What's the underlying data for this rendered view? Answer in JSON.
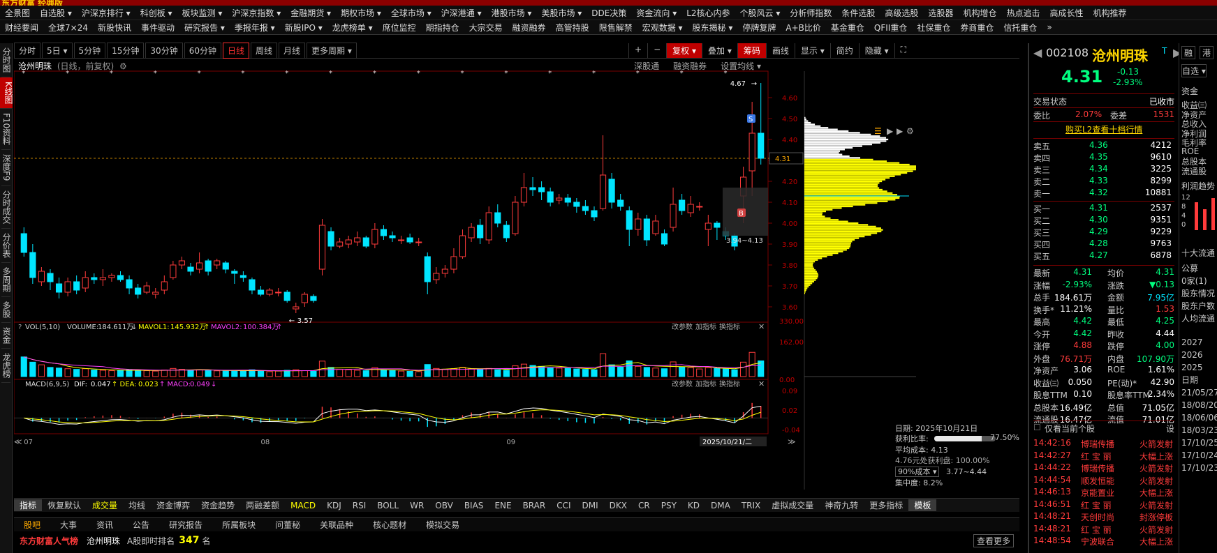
{
  "app": {
    "logo": "东方财富 经典版"
  },
  "menu_row1": [
    "全景图",
    "自选股 ▾",
    "沪深京排行 ▾",
    "科创板 ▾",
    "板块监测 ▾",
    "沪深京指数 ▾",
    "金融期货 ▾",
    "期权市场 ▾",
    "全球市场 ▾",
    "沪深港通 ▾",
    "港股市场 ▾",
    "美股市场 ▾",
    "DDE决策",
    "资金流向 ▾",
    "L2核心内参",
    "个股风云 ▾",
    "分析师指数",
    "条件选股",
    "高级选股",
    "选股器",
    "机构增仓",
    "热点追击",
    "高成长性",
    "机构推荐"
  ],
  "menu_row2": [
    "财经要闻",
    "全球7×24",
    "新股快讯",
    "事件驱动",
    "研究报告 ▾",
    "季报年报 ▾",
    "新股IPO ▾",
    "龙虎榜单 ▾",
    "席位监控",
    "期指持仓",
    "大宗交易",
    "融资融券",
    "高管持股",
    "限售解禁",
    "宏观数据 ▾",
    "股东揭秘 ▾",
    "停牌复牌",
    "A+B比价",
    "基金重仓",
    "QFII重仓",
    "社保重仓",
    "券商重仓",
    "信托重仓",
    "»"
  ],
  "left_nav": [
    {
      "label": "分时图",
      "active": false
    },
    {
      "label": "K线图",
      "active": true
    },
    {
      "label": "F10资料",
      "active": false
    },
    {
      "label": "深度F9",
      "active": false
    },
    {
      "label": "分时成交",
      "active": false
    },
    {
      "label": "分价表",
      "active": false
    },
    {
      "label": "多周期",
      "active": false
    },
    {
      "label": "多股",
      "active": false
    },
    {
      "label": "资金",
      "active": false
    },
    {
      "label": "龙虎榜",
      "active": false
    }
  ],
  "periods": [
    {
      "label": "分时",
      "active": false
    },
    {
      "label": "5日 ▾",
      "active": false
    },
    {
      "label": "5分钟",
      "active": false
    },
    {
      "label": "15分钟",
      "active": false
    },
    {
      "label": "30分钟",
      "active": false
    },
    {
      "label": "60分钟",
      "active": false
    },
    {
      "label": "日线",
      "active": true
    },
    {
      "label": "周线",
      "active": false
    },
    {
      "label": "月线",
      "active": false
    },
    {
      "label": "更多周期 ▾",
      "active": false
    }
  ],
  "toolbar_right": [
    {
      "label": "+",
      "red": false
    },
    {
      "label": "−",
      "red": false
    },
    {
      "label": "复权 ▾",
      "red": true
    },
    {
      "label": "叠加 ▾",
      "red": false
    },
    {
      "label": "筹码",
      "red": true
    },
    {
      "label": "画线",
      "red": false
    },
    {
      "label": "显示 ▾",
      "red": false
    },
    {
      "label": "简约",
      "red": false
    },
    {
      "label": "隐藏 ▾",
      "red": false
    },
    {
      "label": "⛶",
      "red": false
    }
  ],
  "chart_header": {
    "name": "沧州明珠",
    "mode": "(日线，前复权)",
    "links": [
      "深股通",
      "融资融券",
      "设置均线 ▾"
    ]
  },
  "chart_data": {
    "type": "candlestick",
    "title": "沧州明珠 (日线，前复权)",
    "x_month_labels": [
      "07",
      "08",
      "09",
      "10"
    ],
    "x_cursor_label": "2025/10/21/二",
    "ylim": [
      3.55,
      4.7
    ],
    "y_ticks": [
      3.6,
      3.7,
      3.8,
      3.9,
      4.0,
      4.1,
      4.2,
      4.3,
      4.4,
      4.5,
      4.6
    ],
    "current_price": 4.31,
    "annotations": {
      "high_label": "4.67",
      "low_label": "3.57",
      "range_label": "3.94~4.13",
      "buy_marker": "B",
      "sell_marker": "S"
    },
    "candles": [
      [
        3.95,
        3.86,
        3.98,
        3.84
      ],
      [
        3.86,
        3.74,
        3.9,
        3.71
      ],
      [
        3.72,
        3.77,
        3.79,
        3.7
      ],
      [
        3.76,
        3.72,
        3.78,
        3.68
      ],
      [
        3.71,
        3.67,
        3.74,
        3.64
      ],
      [
        3.67,
        3.72,
        3.74,
        3.65
      ],
      [
        3.72,
        3.68,
        3.75,
        3.66
      ],
      [
        3.69,
        3.74,
        3.77,
        3.67
      ],
      [
        3.74,
        3.73,
        3.76,
        3.71
      ],
      [
        3.73,
        3.74,
        3.78,
        3.7
      ],
      [
        3.74,
        3.75,
        3.76,
        3.72
      ],
      [
        3.75,
        3.73,
        3.77,
        3.72
      ],
      [
        3.73,
        3.69,
        3.75,
        3.66
      ],
      [
        3.69,
        3.66,
        3.71,
        3.64
      ],
      [
        3.67,
        3.7,
        3.72,
        3.66
      ],
      [
        3.66,
        3.67,
        3.69,
        3.64
      ],
      [
        3.68,
        3.72,
        3.75,
        3.66
      ],
      [
        3.74,
        3.8,
        3.82,
        3.73
      ],
      [
        3.8,
        3.82,
        3.84,
        3.78
      ],
      [
        3.79,
        3.77,
        3.81,
        3.75
      ],
      [
        3.78,
        3.81,
        3.86,
        3.76
      ],
      [
        3.82,
        3.77,
        3.83,
        3.75
      ],
      [
        3.8,
        3.82,
        3.83,
        3.78
      ],
      [
        3.81,
        3.78,
        3.82,
        3.76
      ],
      [
        3.77,
        3.76,
        3.78,
        3.71
      ],
      [
        3.75,
        3.74,
        3.77,
        3.72
      ],
      [
        3.73,
        3.68,
        3.74,
        3.66
      ],
      [
        3.68,
        3.66,
        3.7,
        3.65
      ],
      [
        3.66,
        3.68,
        3.69,
        3.65
      ],
      [
        3.67,
        3.67,
        3.69,
        3.65
      ],
      [
        3.67,
        3.63,
        3.68,
        3.62
      ],
      [
        3.59,
        3.6,
        3.62,
        3.57
      ],
      [
        3.62,
        3.66,
        3.67,
        3.6
      ],
      [
        3.65,
        3.63,
        3.66,
        3.62
      ],
      [
        3.78,
        3.99,
        4.02,
        3.75
      ],
      [
        3.96,
        3.89,
        3.98,
        3.87
      ],
      [
        3.89,
        3.91,
        3.93,
        3.88
      ],
      [
        3.9,
        3.92,
        3.94,
        3.88
      ],
      [
        3.91,
        3.93,
        3.96,
        3.89
      ],
      [
        3.93,
        3.89,
        3.94,
        3.88
      ],
      [
        3.9,
        3.97,
        4.0,
        3.88
      ],
      [
        3.97,
        3.94,
        3.99,
        3.92
      ],
      [
        3.94,
        3.93,
        3.96,
        3.91
      ],
      [
        3.92,
        3.92,
        3.94,
        3.9
      ],
      [
        3.93,
        3.91,
        3.95,
        3.9
      ],
      [
        3.91,
        3.91,
        3.93,
        3.89
      ],
      [
        3.84,
        3.72,
        3.86,
        3.66
      ],
      [
        3.73,
        3.76,
        3.79,
        3.71
      ],
      [
        3.76,
        3.78,
        3.8,
        3.74
      ],
      [
        3.78,
        3.84,
        3.88,
        3.76
      ],
      [
        3.84,
        3.94,
        3.97,
        3.83
      ],
      [
        3.93,
        3.98,
        4.0,
        3.91
      ],
      [
        3.99,
        3.93,
        4.02,
        3.9
      ],
      [
        3.92,
        4.05,
        4.08,
        3.9
      ],
      [
        4.05,
        4.0,
        4.09,
        3.98
      ],
      [
        3.99,
        3.93,
        4.01,
        3.91
      ],
      [
        3.95,
        4.1,
        4.13,
        3.94
      ],
      [
        4.1,
        4.17,
        4.24,
        4.08
      ],
      [
        4.17,
        4.16,
        4.22,
        4.13
      ],
      [
        4.17,
        4.15,
        4.2,
        4.11
      ],
      [
        4.15,
        4.1,
        4.17,
        4.08
      ],
      [
        4.11,
        4.12,
        4.14,
        4.09
      ],
      [
        4.12,
        4.1,
        4.14,
        4.08
      ],
      [
        4.1,
        4.08,
        4.12,
        4.05
      ],
      [
        4.08,
        4.06,
        4.11,
        4.04
      ],
      [
        4.06,
        4.03,
        4.08,
        4.01
      ],
      [
        4.07,
        4.23,
        4.42,
        4.06
      ],
      [
        4.21,
        4.1,
        4.24,
        4.07
      ],
      [
        4.11,
        4.08,
        4.14,
        4.06
      ],
      [
        4.06,
        3.97,
        4.08,
        3.89
      ],
      [
        3.97,
        4.02,
        4.05,
        3.94
      ],
      [
        4.02,
        3.92,
        4.04,
        3.89
      ],
      [
        3.95,
        4.01,
        4.04,
        3.94
      ],
      [
        3.95,
        3.9,
        3.97,
        3.89
      ],
      [
        3.98,
        4.09,
        4.17,
        3.96
      ],
      [
        4.11,
        4.06,
        4.14,
        4.04
      ],
      [
        4.05,
        4.09,
        4.13,
        4.03
      ],
      [
        4.08,
        4.08,
        4.1,
        4.06
      ],
      [
        3.97,
        4.0,
        4.04,
        3.89
      ],
      [
        4.0,
        3.98,
        4.01,
        3.92
      ],
      [
        3.96,
        3.94,
        3.98,
        3.92
      ],
      [
        3.94,
        3.89,
        3.95,
        3.87
      ],
      [
        4.13,
        4.22,
        4.27,
        4.0
      ],
      [
        4.25,
        4.43,
        4.58,
        4.13
      ],
      [
        4.43,
        4.31,
        4.67,
        4.28
      ]
    ],
    "volume": {
      "label": "VOL(5,10)",
      "ylim": [
        0,
        330
      ],
      "y_ticks": [
        "330.00",
        "162.00",
        "0.00"
      ],
      "last": "184.611万",
      "mavol1": "145.932万",
      "mavol2": "100.384万",
      "values": [
        150,
        110,
        90,
        70,
        65,
        60,
        55,
        60,
        50,
        48,
        45,
        46,
        52,
        48,
        45,
        42,
        50,
        62,
        55,
        48,
        52,
        45,
        44,
        42,
        48,
        45,
        52,
        40,
        38,
        42,
        48,
        52,
        45,
        40,
        118,
        70,
        55,
        52,
        48,
        45,
        68,
        50,
        45,
        42,
        40,
        38,
        92,
        62,
        55,
        60,
        70,
        60,
        55,
        62,
        52,
        48,
        82,
        95,
        85,
        78,
        70,
        65,
        62,
        58,
        55,
        52,
        175,
        90,
        72,
        120,
        78,
        70,
        65,
        60,
        112,
        72,
        68,
        58,
        68,
        62,
        58,
        52,
        110,
        185,
        120
      ]
    },
    "macd": {
      "label": "MACD(6,9,5)",
      "ylim": [
        -0.06,
        0.11
      ],
      "y_ticks": [
        "0.09",
        "0.02",
        "-0.04"
      ],
      "dif": "0.047",
      "dea": "0.023",
      "macd": "0.049"
    }
  },
  "chip_info": {
    "date": "日期: 2025年10月21日",
    "profit_ratio_label": "获利比率:",
    "profit_ratio": "77.50%",
    "avg_cost": "平均成本: 4.13",
    "profit_at": "4.76元处获利盘: 100.00%",
    "cost_select": "90%成本 ▾",
    "cost_range": "3.77~4.44",
    "concentration": "集中度: 8.2%",
    "bar_fill": 0.775
  },
  "chip_ticks": [
    "4.31"
  ],
  "quote": {
    "code": "002108",
    "name": "沧州明珠",
    "price": "4.31",
    "change": "-0.13",
    "pct": "-2.93%",
    "state_label": "交易状态",
    "state_value": "已收市",
    "weibi_label": "委比",
    "weibi": "2.07%",
    "weicha_label": "委差",
    "weicha": "1531",
    "l2_link": "购买L2查看十档行情",
    "asks": [
      {
        "l": "卖五",
        "p": "4.36",
        "v": "4212"
      },
      {
        "l": "卖四",
        "p": "4.35",
        "v": "9610"
      },
      {
        "l": "卖三",
        "p": "4.34",
        "v": "3225"
      },
      {
        "l": "卖二",
        "p": "4.33",
        "v": "8299"
      },
      {
        "l": "卖一",
        "p": "4.32",
        "v": "10881"
      }
    ],
    "bids": [
      {
        "l": "买一",
        "p": "4.31",
        "v": "2537"
      },
      {
        "l": "买二",
        "p": "4.30",
        "v": "9351"
      },
      {
        "l": "买三",
        "p": "4.29",
        "v": "9229"
      },
      {
        "l": "买四",
        "p": "4.28",
        "v": "9763"
      },
      {
        "l": "买五",
        "p": "4.27",
        "v": "6878"
      }
    ],
    "stats": [
      {
        "l1": "最新",
        "v1": "4.31",
        "c1": "grn",
        "l2": "均价",
        "v2": "4.31",
        "c2": "grn"
      },
      {
        "l1": "涨幅",
        "v1": "-2.93%",
        "c1": "grn",
        "l2": "涨跌",
        "v2": "▼0.13",
        "c2": "grn"
      },
      {
        "l1": "总手",
        "v1": "184.61万",
        "c1": "wht",
        "l2": "金额",
        "v2": "7.95亿",
        "c2": "cyan"
      },
      {
        "l1": "换手*",
        "v1": "11.21%",
        "c1": "wht",
        "l2": "量比",
        "v2": "1.53",
        "c2": "red"
      },
      {
        "l1": "最高",
        "v1": "4.42",
        "c1": "grn",
        "l2": "最低",
        "v2": "4.25",
        "c2": "grn"
      },
      {
        "l1": "今开",
        "v1": "4.42",
        "c1": "grn",
        "l2": "昨收",
        "v2": "4.44",
        "c2": "wht"
      },
      {
        "l1": "涨停",
        "v1": "4.88",
        "c1": "red",
        "l2": "跌停",
        "v2": "4.00",
        "c2": "grn"
      },
      {
        "l1": "外盘",
        "v1": "76.71万",
        "c1": "red",
        "l2": "内盘",
        "v2": "107.90万",
        "c2": "grn"
      },
      {
        "l1": "净资产",
        "v1": "3.06",
        "c1": "wht",
        "l2": "ROE",
        "v2": "1.61%",
        "c2": "wht"
      },
      {
        "l1": "收益㈢",
        "v1": "0.050",
        "c1": "wht",
        "l2": "PE(动)*",
        "v2": "42.90",
        "c2": "wht"
      },
      {
        "l1": "股息TTM",
        "v1": "0.10",
        "c1": "wht",
        "l2": "股息率TTM",
        "v2": "2.34%",
        "c2": "wht"
      },
      {
        "l1": "总股本",
        "v1": "16.49亿",
        "c1": "wht",
        "l2": "总值",
        "v2": "71.05亿",
        "c2": "wht"
      },
      {
        "l1": "流通股",
        "v1": "16.47亿",
        "c1": "wht",
        "l2": "流值",
        "v2": "71.01亿",
        "c2": "wht"
      }
    ],
    "only_current_label": "仅看当前个股",
    "settings_label": "设",
    "alerts": [
      {
        "t": "14:42:16",
        "n": "博瑞传播",
        "e": "火箭发射"
      },
      {
        "t": "14:42:27",
        "n": "红 宝 丽",
        "e": "大幅上涨"
      },
      {
        "t": "14:44:22",
        "n": "博瑞传播",
        "e": "火箭发射"
      },
      {
        "t": "14:44:54",
        "n": "顺发恒能",
        "e": "火箭发射"
      },
      {
        "t": "14:46:13",
        "n": "京能置业",
        "e": "大幅上涨"
      },
      {
        "t": "14:46:51",
        "n": "红 宝 丽",
        "e": "火箭发射"
      },
      {
        "t": "14:48:21",
        "n": "天创时尚",
        "e": "封涨停板"
      },
      {
        "t": "14:48:21",
        "n": "红 宝 丽",
        "e": "火箭发射"
      },
      {
        "t": "14:48:54",
        "n": "宁波联合",
        "e": "大幅上涨"
      }
    ]
  },
  "far_right": {
    "top_buttons": [
      "融",
      "港"
    ],
    "self_select": "自选 ▾",
    "funds": "资金",
    "items": [
      "收益㈢",
      "净资产",
      "总收入",
      "净利润",
      "毛利率",
      "ROE",
      "总股本",
      "流通股"
    ],
    "trend_title": "利润趋势",
    "trend_ticks": [
      "12",
      "8",
      "4",
      "0"
    ],
    "top10": "十大流通",
    "gongmu": "公募",
    "jigou": "0家(1)",
    "holders": [
      "股东情况",
      "股东户数",
      "人均流通"
    ],
    "years": [
      "2027",
      "2026",
      "2025"
    ],
    "date_head": "日期",
    "dates": [
      "21/05/27",
      "18/08/20",
      "18/06/06",
      "18/03/23",
      "17/10/25",
      "17/10/24",
      "17/10/23"
    ]
  },
  "indicators": [
    {
      "label": "指标",
      "on": true
    },
    {
      "label": "恢复默认",
      "on": false
    },
    {
      "label": "成交量",
      "on": false,
      "y": true
    },
    {
      "label": "均线",
      "on": false
    },
    {
      "label": "资金博弈",
      "on": false
    },
    {
      "label": "资金趋势",
      "on": false
    },
    {
      "label": "两融差额",
      "on": false
    },
    {
      "label": "MACD",
      "on": false,
      "y": true
    },
    {
      "label": "KDJ",
      "on": false
    },
    {
      "label": "RSI",
      "on": false
    },
    {
      "label": "BOLL",
      "on": false
    },
    {
      "label": "WR",
      "on": false
    },
    {
      "label": "OBV",
      "on": false
    },
    {
      "label": "BIAS",
      "on": false
    },
    {
      "label": "ENE",
      "on": false
    },
    {
      "label": "BRAR",
      "on": false
    },
    {
      "label": "CCI",
      "on": false
    },
    {
      "label": "DMI",
      "on": false
    },
    {
      "label": "DKX",
      "on": false
    },
    {
      "label": "CR",
      "on": false
    },
    {
      "label": "PSY",
      "on": false
    },
    {
      "label": "KD",
      "on": false
    },
    {
      "label": "DMA",
      "on": false
    },
    {
      "label": "TRIX",
      "on": false
    },
    {
      "label": "虚拟成交量",
      "on": false
    },
    {
      "label": "神奇九转",
      "on": false
    },
    {
      "label": "更多指标",
      "on": false
    },
    {
      "label": "模板",
      "on": true
    }
  ],
  "tabs": [
    {
      "label": "股吧",
      "on": true
    },
    {
      "label": "大事",
      "on": false
    },
    {
      "label": "资讯",
      "on": false
    },
    {
      "label": "公告",
      "on": false
    },
    {
      "label": "研究报告",
      "on": false
    },
    {
      "label": "所属板块",
      "on": false
    },
    {
      "label": "问董秘",
      "on": false
    },
    {
      "label": "关联品种",
      "on": false
    },
    {
      "label": "核心题材",
      "on": false
    },
    {
      "label": "模拟交易",
      "on": false
    }
  ],
  "rank": {
    "title": "东方财富人气榜",
    "name": "沧州明珠",
    "label": "A股即时排名",
    "value": "347",
    "unit": "名",
    "more": "查看更多"
  },
  "colors": {
    "up": "#ff3b3b",
    "down": "#00e5ff",
    "ma1": "#ffff00",
    "ma2": "#ff40ff",
    "accent": "#c00000"
  }
}
